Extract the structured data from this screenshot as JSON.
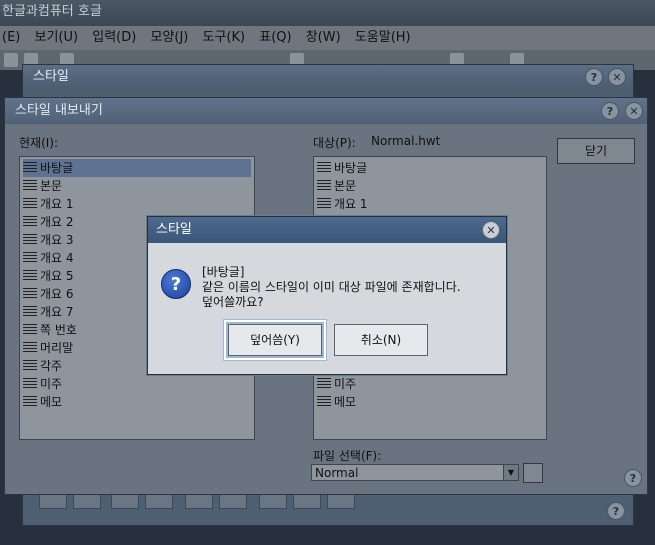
{
  "app": {
    "title": "한글과컴퓨터 호글",
    "menu": [
      "(E)",
      "보기(U)",
      "입력(D)",
      "모양(J)",
      "도구(K)",
      "표(Q)",
      "창(W)",
      "도움말(H)"
    ]
  },
  "style_window": {
    "title": "스타일"
  },
  "export_window": {
    "title": "스타일 내보내기",
    "current_label": "현재(I):",
    "target_label": "대상(P):",
    "target_value": "Normal.hwt",
    "close_button": "닫기",
    "current_items": [
      "바탕글",
      "본문",
      "개요 1",
      "개요 2",
      "개요 3",
      "개요 4",
      "개요 5",
      "개요 6",
      "개요 7",
      "쪽 번호",
      "머리말",
      "각주",
      "미주",
      "메모"
    ],
    "target_items_top": [
      "바탕글",
      "본문",
      "개요 1"
    ],
    "target_items_bottom": [
      "미주",
      "메모"
    ],
    "file_select_label": "파일 선택(F):",
    "file_select_value": "Normal"
  },
  "dialog": {
    "title": "스타일",
    "message_line1": "[바탕글]",
    "message_line2": "같은 이름의 스타일이 이미 대상 파일에 존재합니다.",
    "message_line3": "덮어쓸까요?",
    "overwrite_button": "덮어씀(Y)",
    "cancel_button": "취소(N)"
  },
  "colors": {
    "dialog_title": "#3f5c80",
    "selection": "#5d7391"
  }
}
